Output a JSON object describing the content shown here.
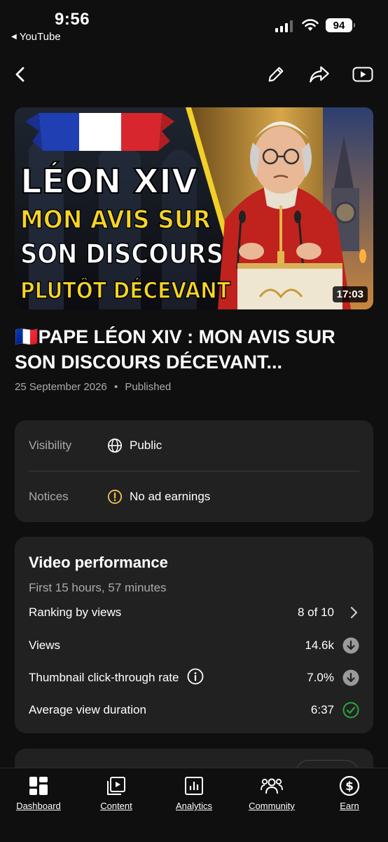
{
  "status_bar": {
    "time": "9:56",
    "back_app": "YouTube",
    "battery": "94"
  },
  "thumbnail": {
    "line1": "LÉON XIV",
    "line2": "MON AVIS SUR",
    "line3": "SON DISCOURS",
    "line4": "PLUTÔT DÉCEVANT",
    "duration": "17:03"
  },
  "video": {
    "flag": "🇫🇷",
    "title": "PAPE LÉON XIV : MON AVIS SUR SON DISCOURS DÉCEVANT...",
    "date": "25 September 2026",
    "separator": "•",
    "status": "Published"
  },
  "details": {
    "visibility_label": "Visibility",
    "visibility_value": "Public",
    "notices_label": "Notices",
    "notices_value": "No ad earnings"
  },
  "performance": {
    "title": "Video performance",
    "subtitle": "First 15 hours, 57 minutes",
    "rows": [
      {
        "label": "Ranking by views",
        "value": "8 of 10",
        "indicator": "chevron-right"
      },
      {
        "label": "Views",
        "value": "14.6k",
        "indicator": "arrow-down"
      },
      {
        "label": "Thumbnail click-through rate",
        "value": "7.0%",
        "indicator": "arrow-down"
      },
      {
        "label": "Average view duration",
        "value": "6:37",
        "indicator": "check"
      }
    ]
  },
  "colors": {
    "background": "#0f0f0f",
    "card": "#212121",
    "warning": "#f2c14e",
    "success": "#2ba640",
    "muted": "#aaaaaa"
  },
  "nav": [
    {
      "label": "Dashboard",
      "icon": "dashboard-icon"
    },
    {
      "label": "Content",
      "icon": "content-icon"
    },
    {
      "label": "Analytics",
      "icon": "analytics-icon"
    },
    {
      "label": "Community",
      "icon": "community-icon"
    },
    {
      "label": "Earn",
      "icon": "earn-icon"
    }
  ]
}
